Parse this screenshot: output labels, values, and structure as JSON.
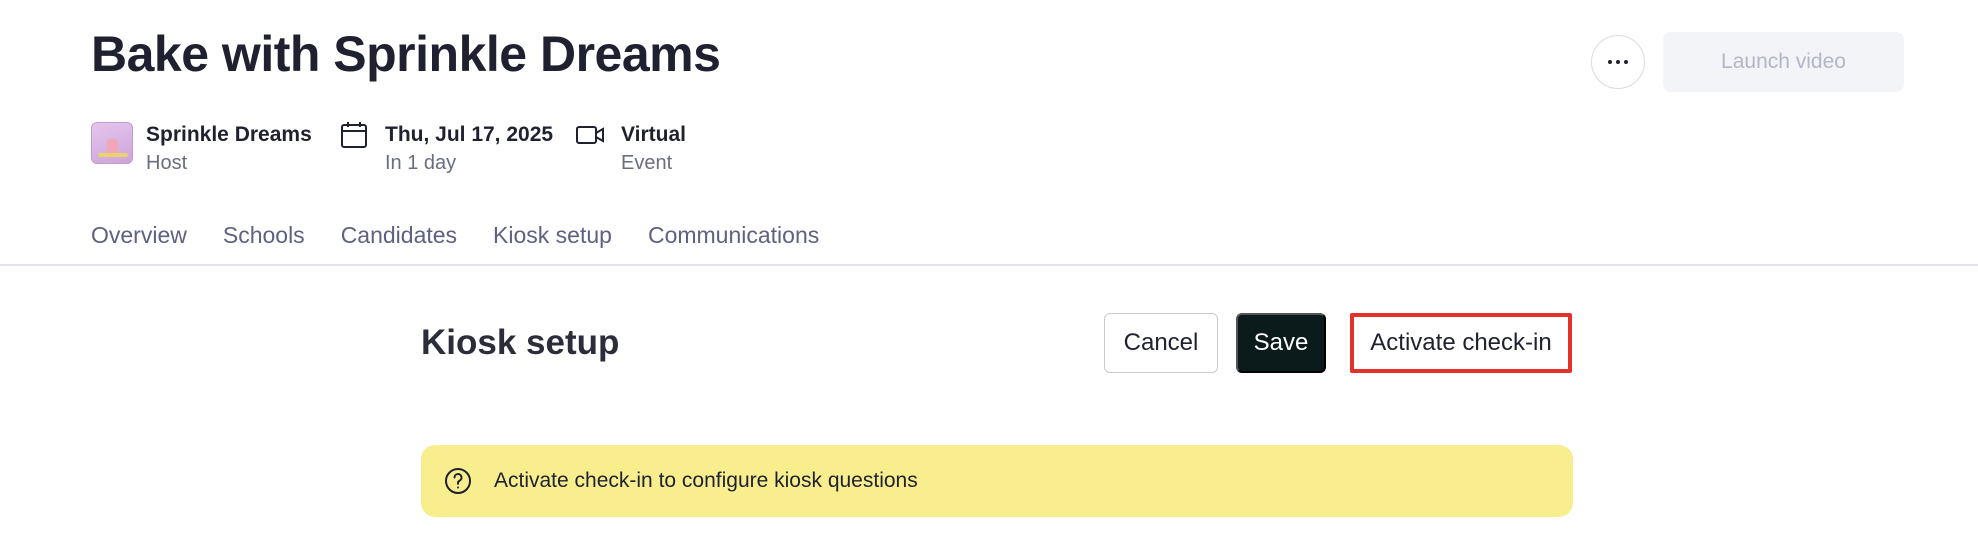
{
  "header": {
    "title": "Bake with Sprinkle Dreams",
    "more_icon": "more-horizontal-icon",
    "launch_label": "Launch video"
  },
  "meta": {
    "host": {
      "name": "Sprinkle Dreams",
      "role": "Host"
    },
    "date": {
      "label": "Thu, Jul 17, 2025",
      "sub": "In 1 day",
      "icon": "calendar-icon"
    },
    "format": {
      "label": "Virtual",
      "sub": "Event",
      "icon": "video-camera-icon"
    }
  },
  "tabs": [
    "Overview",
    "Schools",
    "Candidates",
    "Kiosk setup",
    "Communications"
  ],
  "section": {
    "title": "Kiosk setup",
    "cancel_label": "Cancel",
    "save_label": "Save",
    "activate_label": "Activate check-in"
  },
  "banner": {
    "icon": "question-circle-icon",
    "text": "Activate check-in to configure kiosk questions"
  },
  "colors": {
    "save_bg": "#0b1a1a",
    "banner_bg": "#f8ee8e",
    "highlight_border": "#e4322b",
    "tab_text": "#5e6280"
  }
}
